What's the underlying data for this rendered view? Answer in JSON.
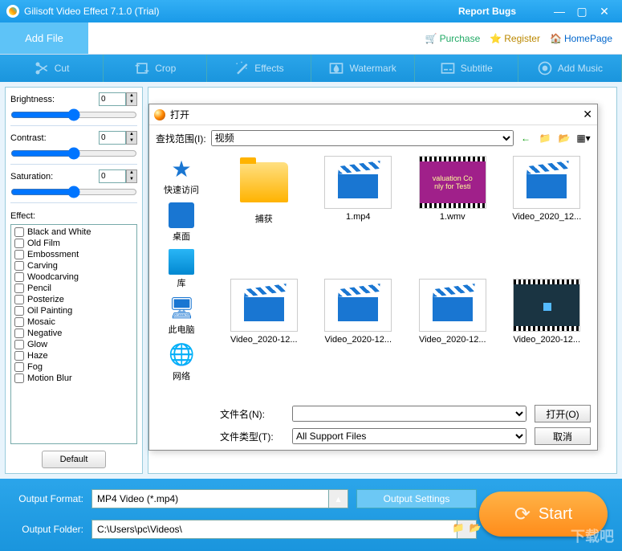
{
  "titlebar": {
    "title": "Gilisoft Video Effect 7.1.0 (Trial)",
    "report": "Report Bugs"
  },
  "menubar": {
    "add_file": "Add File",
    "purchase": "Purchase",
    "register": "Register",
    "homepage": "HomePage"
  },
  "tabs": [
    {
      "label": "Cut"
    },
    {
      "label": "Crop"
    },
    {
      "label": "Effects"
    },
    {
      "label": "Watermark"
    },
    {
      "label": "Subtitle"
    },
    {
      "label": "Add Music"
    }
  ],
  "controls": {
    "brightness_label": "Brightness:",
    "brightness_val": "0",
    "contrast_label": "Contrast:",
    "contrast_val": "0",
    "saturation_label": "Saturation:",
    "saturation_val": "0",
    "effect_label": "Effect:",
    "effects": [
      "Black and White",
      "Old Film",
      "Embossment",
      "Carving",
      "Woodcarving",
      "Pencil",
      "Posterize",
      "Oil Painting",
      "Mosaic",
      "Negative",
      "Glow",
      "Haze",
      "Fog",
      "Motion Blur"
    ],
    "default_btn": "Default"
  },
  "dialog": {
    "title": "打开",
    "lookin_label": "查找范围(I):",
    "lookin_value": "视频",
    "places": [
      {
        "label": "快速访问"
      },
      {
        "label": "桌面"
      },
      {
        "label": "库"
      },
      {
        "label": "此电脑"
      },
      {
        "label": "网络"
      }
    ],
    "files": [
      {
        "name": "捕获",
        "type": "folder"
      },
      {
        "name": "1.mp4",
        "type": "video"
      },
      {
        "name": "1.wmv",
        "type": "wmv",
        "overlay1": "valuation Co",
        "overlay2": "nly for Testi"
      },
      {
        "name": "Video_2020_12...",
        "type": "video"
      },
      {
        "name": "Video_2020-12...",
        "type": "video"
      },
      {
        "name": "Video_2020-12...",
        "type": "video"
      },
      {
        "name": "Video_2020-12...",
        "type": "video"
      },
      {
        "name": "Video_2020-12...",
        "type": "dark"
      }
    ],
    "filename_label": "文件名(N):",
    "filename_value": "",
    "filetype_label": "文件类型(T):",
    "filetype_value": "All Support Files",
    "open_btn": "打开(O)",
    "cancel_btn": "取消"
  },
  "bottom": {
    "format_label": "Output Format:",
    "format_value": "MP4 Video (*.mp4)",
    "settings_btn": "Output Settings",
    "folder_label": "Output Folder:",
    "folder_value": "C:\\Users\\pc\\Videos\\",
    "start_btn": "Start"
  },
  "watermark": "下载吧"
}
